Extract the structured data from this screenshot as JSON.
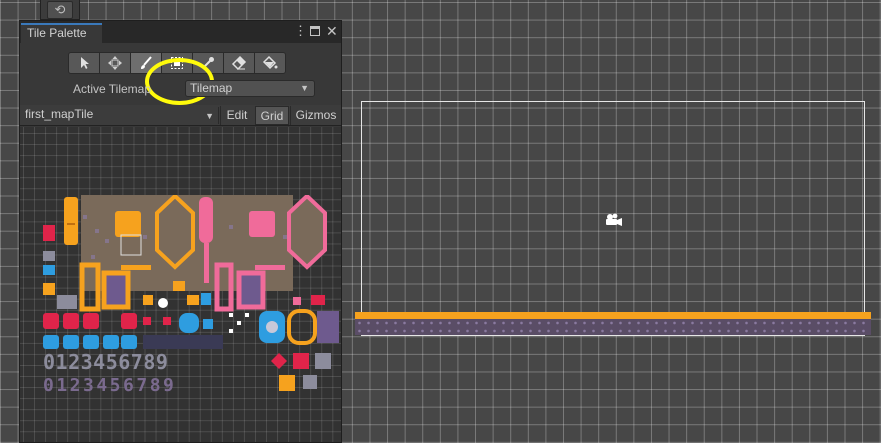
{
  "mini_tool": {
    "icon": "rotate-icon",
    "glyph": "⟲"
  },
  "palette_window": {
    "tab_title": "Tile Palette",
    "menu_glyph": "⋮",
    "close_glyph": "✕",
    "tools": [
      {
        "name": "select-tool",
        "icon": "arrow-icon"
      },
      {
        "name": "move-tool",
        "icon": "move-icon"
      },
      {
        "name": "paint-brush-tool",
        "icon": "brush-icon",
        "active": true
      },
      {
        "name": "box-fill-tool",
        "icon": "box-fill-icon"
      },
      {
        "name": "picker-tool",
        "icon": "eyedropper-icon"
      },
      {
        "name": "eraser-tool",
        "icon": "eraser-icon"
      },
      {
        "name": "flood-fill-tool",
        "icon": "paint-bucket-icon"
      }
    ],
    "active_tilemap_label": "Active Tilemap",
    "active_tilemap_value": "Tilemap",
    "palette_select_value": "first_mapTile",
    "edit_label": "Edit",
    "grid_label": "Grid",
    "gizmos_label": "Gizmos",
    "highlight_color": "#fffb0b"
  },
  "scene": {
    "camera_icon": "camera-icon",
    "ground_colors": {
      "top": "#f6a21e",
      "bottom": "#5a4d66"
    }
  },
  "tilesheet": {
    "digits_row": "0123456789",
    "palette_colors": {
      "orange": "#f6a21e",
      "pink": "#f06b9a",
      "brown": "#7a6a5a",
      "purple": "#6e5a8e",
      "red": "#e0244a",
      "blue": "#2e9de0",
      "grey": "#8c8c9c"
    }
  }
}
